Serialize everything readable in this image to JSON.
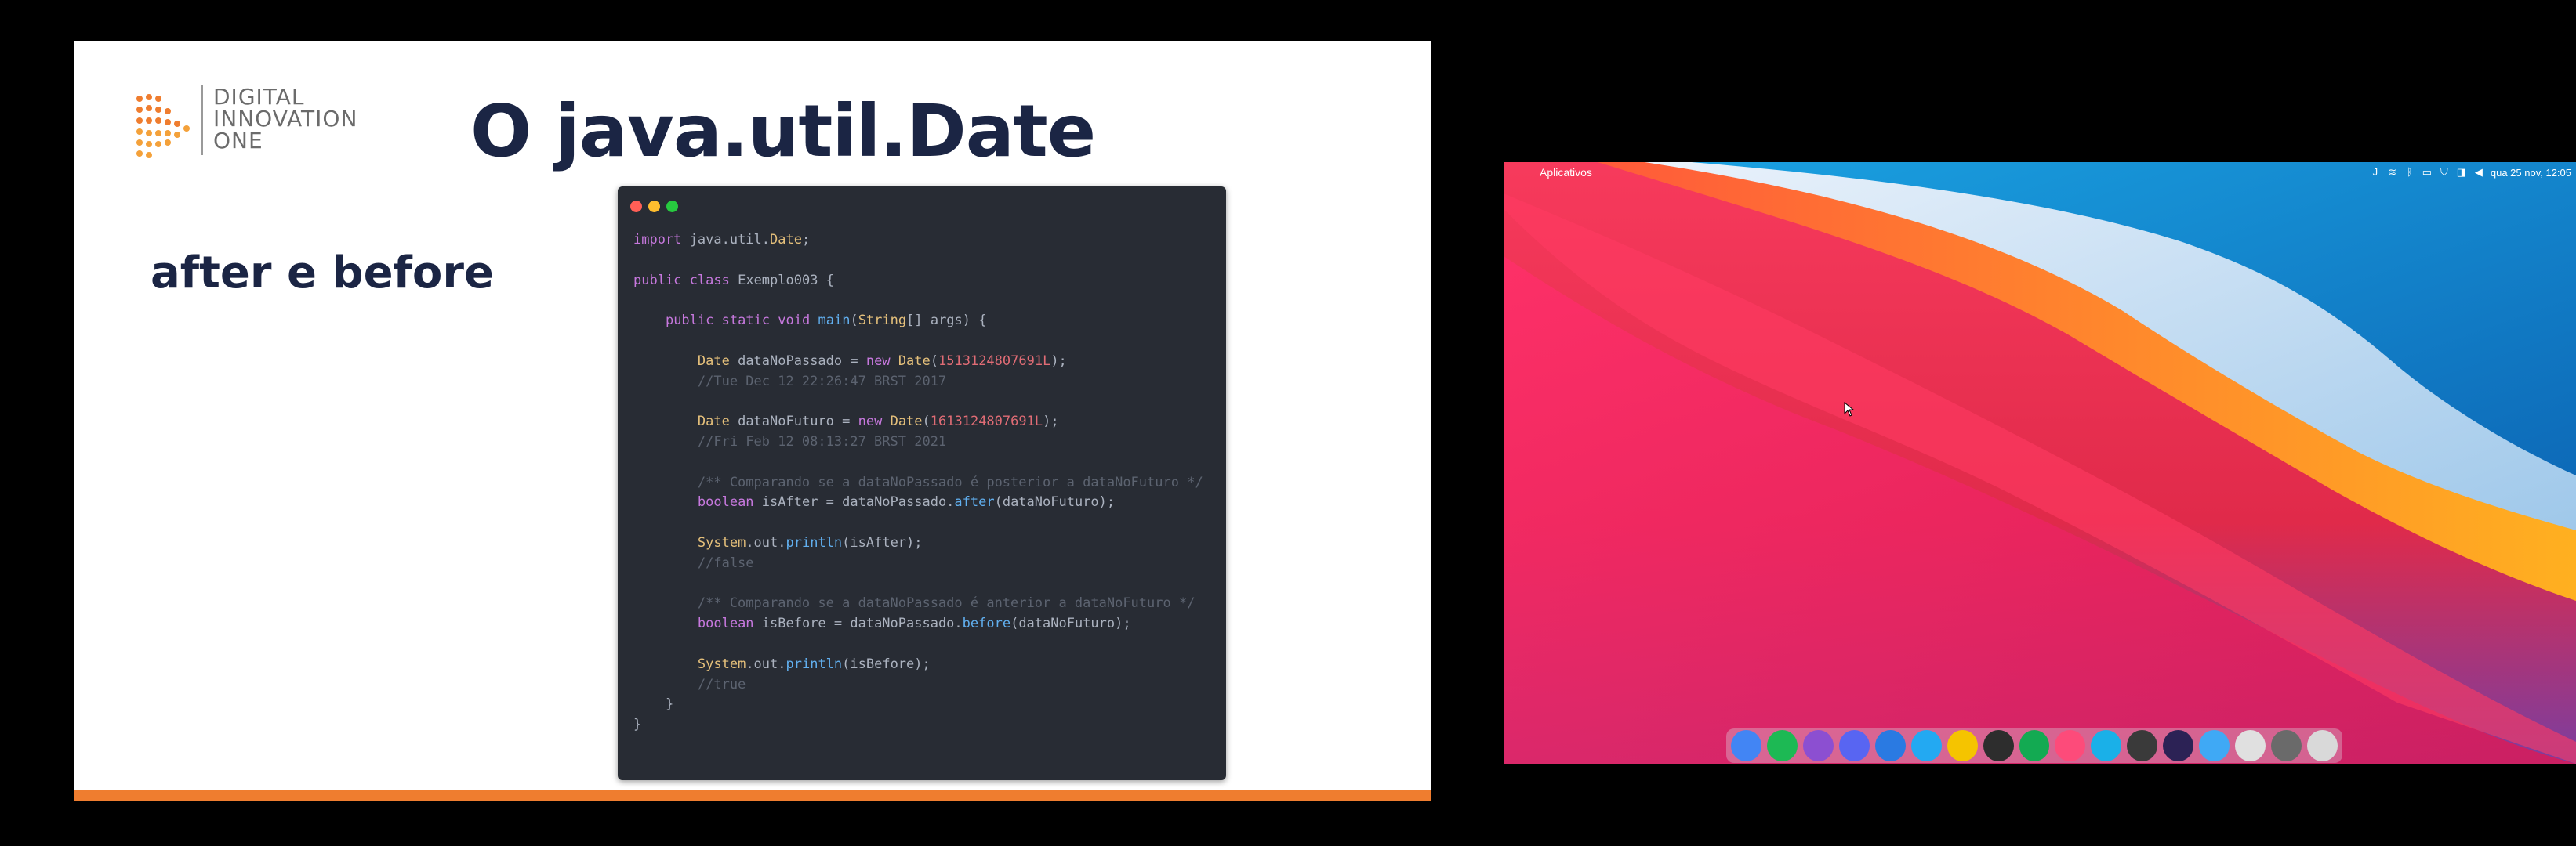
{
  "slide": {
    "logo": {
      "line1": "DIGITAL",
      "line2": "INNOVATION",
      "line3": "ONE"
    },
    "title": "O java.util.Date",
    "subtitle": "after e before",
    "accent_color": "#ef7d2f",
    "title_color": "#1b2544"
  },
  "code": {
    "lines": [
      "import java.util.Date;",
      "",
      "public class Exemplo003 {",
      "",
      "    public static void main(String[] args) {",
      "",
      "        Date dataNoPassado = new Date(1513124807691L);",
      "        //Tue Dec 12 22:26:47 BRST 2017",
      "",
      "        Date dataNoFuturo = new Date(1613124807691L);",
      "        //Fri Feb 12 08:13:27 BRST 2021",
      "",
      "        /** Comparando se a dataNoPassado é posterior a dataNoFuturo */",
      "        boolean isAfter = dataNoPassado.after(dataNoFuturo);",
      "",
      "        System.out.println(isAfter);",
      "        //false",
      "",
      "        /** Comparando se a dataNoPassado é anterior a dataNoFuturo */",
      "        boolean isBefore = dataNoPassado.before(dataNoFuturo);",
      "",
      "        System.out.println(isBefore);",
      "        //true",
      "    }",
      "}"
    ]
  },
  "desktop": {
    "menu_label": "Aplicativos",
    "clock": "qua 25 nov, 12:05",
    "tray_icons": [
      "java-icon",
      "wifi-icon",
      "bluetooth-icon",
      "battery-icon",
      "shield-icon",
      "vpn-icon",
      "volume-icon"
    ],
    "dock_apps": [
      {
        "name": "chrome",
        "color": "#4285f4"
      },
      {
        "name": "spotify",
        "color": "#1db954"
      },
      {
        "name": "game",
        "color": "#8c4fd1"
      },
      {
        "name": "discord",
        "color": "#5865f2"
      },
      {
        "name": "browser",
        "color": "#2a7ae2"
      },
      {
        "name": "vscode",
        "color": "#23a9f2"
      },
      {
        "name": "b-app",
        "color": "#f5c400"
      },
      {
        "name": "gnu",
        "color": "#2d2d2d"
      },
      {
        "name": "mongodb",
        "color": "#13aa52"
      },
      {
        "name": "jetbrains",
        "color": "#fd4b7a"
      },
      {
        "name": "cube",
        "color": "#1ab0e8"
      },
      {
        "name": "typora",
        "color": "#3a3a3a"
      },
      {
        "name": "eclipse",
        "color": "#2c2255"
      },
      {
        "name": "disk",
        "color": "#3fa9f5"
      },
      {
        "name": "sphere",
        "color": "#e0e0e0"
      },
      {
        "name": "settings",
        "color": "#6a6a6a"
      },
      {
        "name": "trash",
        "color": "#d9d9d9"
      }
    ]
  }
}
